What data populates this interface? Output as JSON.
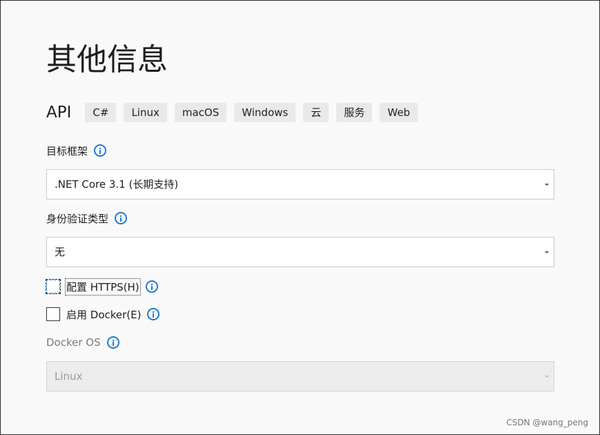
{
  "header": {
    "title": "其他信息"
  },
  "project": {
    "name": "API",
    "tags": [
      "C#",
      "Linux",
      "macOS",
      "Windows",
      "云",
      "服务",
      "Web"
    ]
  },
  "target_framework": {
    "label": "目标框架",
    "value": ".NET Core 3.1 (长期支持)"
  },
  "auth_type": {
    "label": "身份验证类型",
    "value": "无"
  },
  "https": {
    "label": "配置 HTTPS(H)",
    "checked": false
  },
  "docker": {
    "label": "启用 Docker(E)",
    "checked": false
  },
  "docker_os": {
    "label": "Docker OS",
    "value": "Linux"
  },
  "watermark": "CSDN @wang_peng",
  "colors": {
    "accent": "#1f7ad0",
    "background": "#f9f9f9",
    "tag_bg": "#e9e9e9"
  }
}
